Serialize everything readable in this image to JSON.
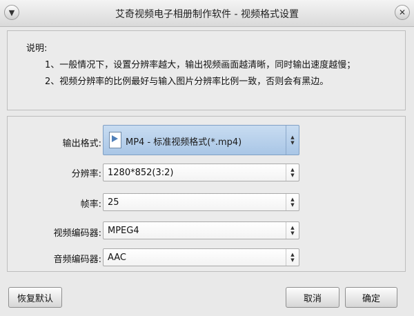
{
  "window": {
    "title": "艾奇视频电子相册制作软件 - 视频格式设置"
  },
  "notes": {
    "heading": "说明:",
    "lines": [
      "1、一般情况下，设置分辨率越大，输出视频画面越清晰，同时输出速度越慢；",
      "2、视频分辨率的比例最好与输入图片分辨率比例一致，否则会有黑边。"
    ]
  },
  "form": {
    "output_format": {
      "label": "输出格式:",
      "value": "MP4 - 标准视频格式(*.mp4)",
      "icon": "mp4-file-icon"
    },
    "resolution": {
      "label": "分辨率:",
      "value": "1280*852(3:2)"
    },
    "frame_rate": {
      "label": "帧率:",
      "value": "25"
    },
    "video_codec": {
      "label": "视频编码器:",
      "value": "MPEG4"
    },
    "audio_codec": {
      "label": "音频编码器:",
      "value": "AAC"
    }
  },
  "buttons": {
    "restore_defaults": "恢复默认",
    "cancel": "取消",
    "ok": "确定"
  }
}
